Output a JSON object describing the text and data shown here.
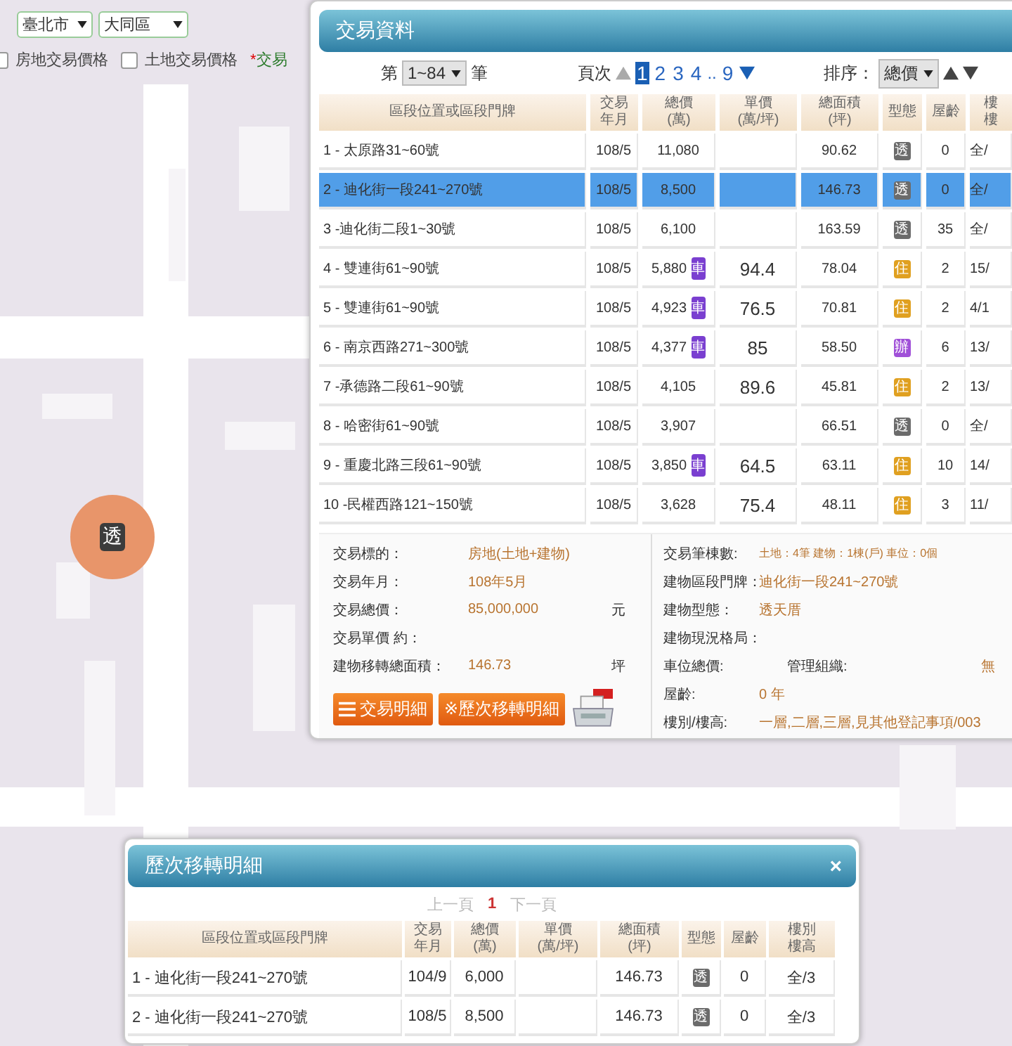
{
  "filters": {
    "city": "臺北市",
    "district": "大同區",
    "options": [
      {
        "label": "房地交易價格",
        "checked": false
      },
      {
        "label": "土地交易價格",
        "checked": false
      }
    ],
    "note_mark": "*",
    "note": "交易"
  },
  "map": {
    "kind": "picture",
    "marker": {
      "label": "透"
    }
  },
  "panel": {
    "title": "交易資料",
    "pager": {
      "prefix": "第",
      "range": "1~84",
      "suffix": "筆",
      "pages_label": "頁次",
      "prev_disabled": true,
      "next_disabled": false,
      "pages": [
        {
          "label": "1",
          "kind": "page",
          "selected": true
        },
        {
          "label": "2",
          "kind": "page",
          "selected": false
        },
        {
          "label": "3",
          "kind": "page",
          "selected": false
        },
        {
          "label": "4",
          "kind": "page",
          "selected": false
        },
        {
          "label": "..",
          "kind": "gap",
          "selected": false
        },
        {
          "label": "9",
          "kind": "page",
          "selected": false
        }
      ],
      "sort_label": "排序：",
      "sort_value": "總價"
    },
    "columns": [
      [
        "區段位置或區段門牌"
      ],
      [
        "交易",
        "年月"
      ],
      [
        "總價",
        "(萬)"
      ],
      [
        "單價",
        "(萬/坪)"
      ],
      [
        "總面積",
        "(坪)"
      ],
      [
        "型態"
      ],
      [
        "屋齡"
      ],
      [
        "樓",
        "樓"
      ]
    ],
    "rows": [
      {
        "address": "1  - 太原路31~60號",
        "date": "108/5",
        "price": "11,080",
        "unit_price": "",
        "area": "90.62",
        "type": "透",
        "kind": "house",
        "age": "0",
        "floor": "全/",
        "selected": false
      },
      {
        "address": "2  - 迪化街一段241~270號",
        "date": "108/5",
        "price": "8,500",
        "unit_price": "",
        "area": "146.73",
        "type": "透",
        "kind": "house",
        "age": "0",
        "floor": "全/",
        "selected": true
      },
      {
        "address": "3  -迪化街二段1~30號",
        "date": "108/5",
        "price": "6,100",
        "unit_price": "",
        "area": "163.59",
        "type": "透",
        "kind": "house",
        "age": "35",
        "floor": "全/",
        "selected": false
      },
      {
        "address": "4  - 雙連街61~90號",
        "date": "108/5",
        "price": "5,880",
        "parking": "車",
        "unit_price": "94.4",
        "area": "78.04",
        "type": "住",
        "kind": "residence",
        "age": "2",
        "floor": "15/",
        "selected": false
      },
      {
        "address": "5  - 雙連街61~90號",
        "date": "108/5",
        "price": "4,923",
        "parking": "車",
        "unit_price": "76.5",
        "area": "70.81",
        "type": "住",
        "kind": "residence",
        "age": "2",
        "floor": "4/1",
        "selected": false
      },
      {
        "address": "6  - 南京西路271~300號",
        "date": "108/5",
        "price": "4,377",
        "parking": "車",
        "unit_price": "85",
        "area": "58.50",
        "type": "辦",
        "kind": "office",
        "age": "6",
        "floor": "13/",
        "selected": false
      },
      {
        "address": "7  -承德路二段61~90號",
        "date": "108/5",
        "price": "4,105",
        "unit_price": "89.6",
        "area": "45.81",
        "type": "住",
        "kind": "residence",
        "age": "2",
        "floor": "13/",
        "selected": false
      },
      {
        "address": "8  - 哈密街61~90號",
        "date": "108/5",
        "price": "3,907",
        "unit_price": "",
        "area": "66.51",
        "type": "透",
        "kind": "house",
        "age": "0",
        "floor": "全/",
        "selected": false
      },
      {
        "address": "9  - 重慶北路三段61~90號",
        "date": "108/5",
        "price": "3,850",
        "parking": "車",
        "unit_price": "64.5",
        "area": "63.11",
        "type": "住",
        "kind": "residence",
        "age": "10",
        "floor": "14/",
        "selected": false
      },
      {
        "address": "10  -民權西路121~150號",
        "date": "108/5",
        "price": "3,628",
        "unit_price": "75.4",
        "area": "48.11",
        "type": "住",
        "kind": "residence",
        "age": "3",
        "floor": "11/",
        "selected": false
      }
    ],
    "details_left": [
      {
        "label": "交易標的：",
        "value": "房地(土地+建物)"
      },
      {
        "label": "交易年月：",
        "value": "108年5月"
      },
      {
        "label": "交易總價：",
        "value": "85,000,000",
        "unit": "元"
      },
      {
        "label": "交易單價 約："
      },
      {
        "label": "建物移轉總面積：",
        "value": "146.73",
        "unit": "坪"
      }
    ],
    "details_right": [
      {
        "label": "交易筆棟數:",
        "value": "土地：4筆 建物：1棟(戶) 車位：0個",
        "small": true
      },
      {
        "label": "建物區段門牌：",
        "value": "迪化街一段241~270號"
      },
      {
        "label": "建物型態：",
        "value": "透天厝"
      },
      {
        "label": "建物現況格局："
      },
      {
        "label": "車位總價:",
        "extra_label": "管理組織:",
        "extra_value": "無"
      },
      {
        "label": "屋齡:",
        "value": "0 年"
      },
      {
        "label": "樓別/樓高:",
        "value": "一層,二層,三層,見其他登記事項/003"
      }
    ],
    "buttons": [
      "交易明細",
      "※歷次移轉明細"
    ]
  },
  "dialog": {
    "title": "歷次移轉明細",
    "close": "×",
    "prev": "上一頁",
    "page": "1",
    "next": "下一頁",
    "columns": [
      [
        "區段位置或區段門牌"
      ],
      [
        "交易",
        "年月"
      ],
      [
        "總價",
        "(萬)"
      ],
      [
        "單價",
        "(萬/坪)"
      ],
      [
        "總面積",
        "(坪)"
      ],
      [
        "型態"
      ],
      [
        "屋齡"
      ],
      [
        "樓別",
        "樓高"
      ]
    ],
    "rows": [
      {
        "address": "1  - 迪化街一段241~270號",
        "date": "104/9",
        "price": "6,000",
        "unit_price": "",
        "area": "146.73",
        "type": "透",
        "kind": "house",
        "age": "0",
        "floor": "全/3"
      },
      {
        "address": "2  - 迪化街一段241~270號",
        "date": "108/5",
        "price": "8,500",
        "unit_price": "",
        "area": "146.73",
        "type": "透",
        "kind": "house",
        "age": "0",
        "floor": "全/3"
      }
    ]
  }
}
